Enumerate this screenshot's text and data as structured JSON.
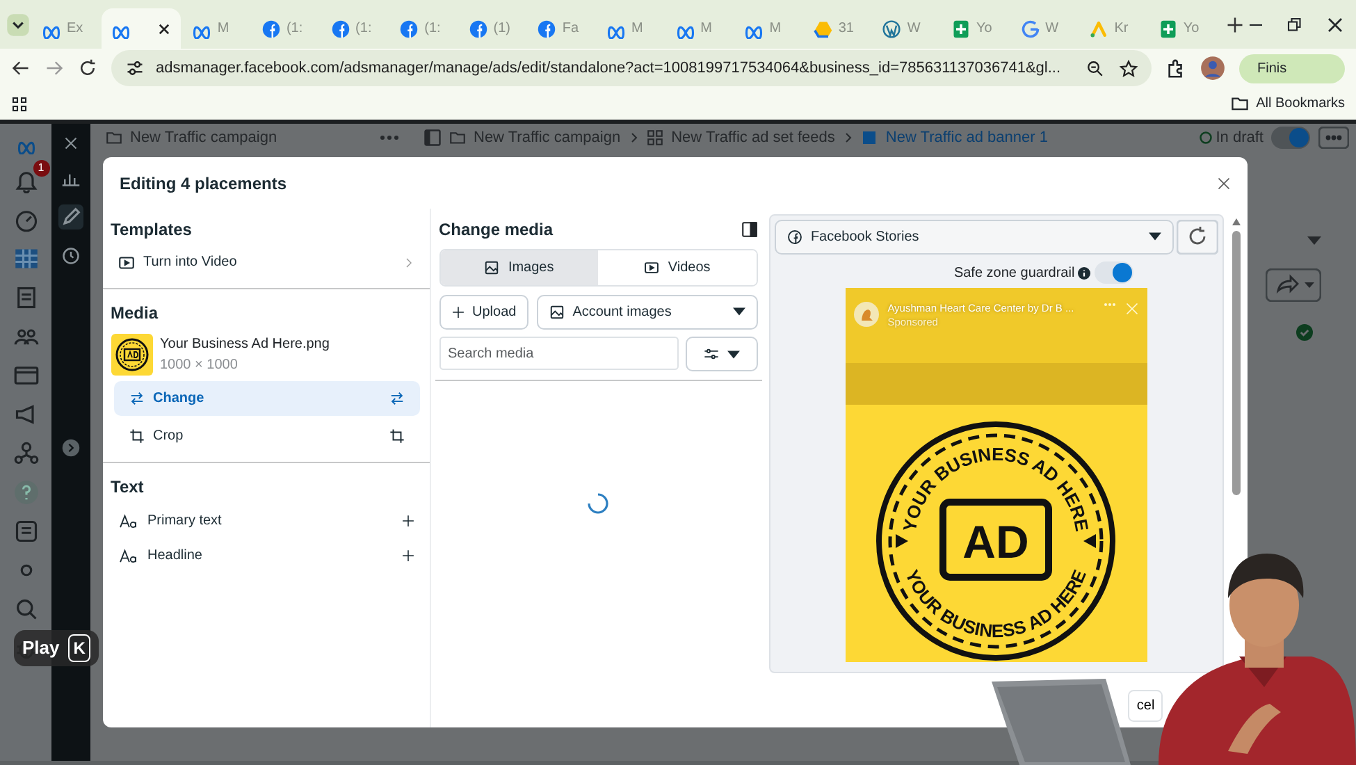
{
  "browser": {
    "tabs": [
      {
        "kind": "meta",
        "label": "Ex",
        "selected": false
      },
      {
        "kind": "meta",
        "selected": true
      },
      {
        "kind": "meta",
        "label": "M",
        "selected": false
      },
      {
        "kind": "facebook",
        "label": "(1:",
        "selected": false
      },
      {
        "kind": "facebook",
        "label": "(1:",
        "selected": false
      },
      {
        "kind": "facebook",
        "label": "(1:",
        "selected": false
      },
      {
        "kind": "facebook",
        "label": "(1)",
        "selected": false
      },
      {
        "kind": "facebook",
        "label": "Fa",
        "selected": false
      },
      {
        "kind": "meta",
        "label": "M",
        "selected": false
      },
      {
        "kind": "meta",
        "label": "M",
        "selected": false
      },
      {
        "kind": "meta",
        "label": "M",
        "selected": false
      },
      {
        "kind": "drive",
        "label": "31",
        "selected": false
      },
      {
        "kind": "wordpress",
        "label": "W",
        "selected": false
      },
      {
        "kind": "sheets",
        "label": "Yo",
        "selected": false
      },
      {
        "kind": "google",
        "label": "W",
        "selected": false
      },
      {
        "kind": "ads",
        "label": "Kr",
        "selected": false
      },
      {
        "kind": "sheets",
        "label": "Yo",
        "selected": false
      }
    ],
    "url": "adsmanager.facebook.com/adsmanager/manage/ads/edit/standalone?act=1008199717534064&business_id=785631137036741&gl...",
    "profile_button": "Finis",
    "bookmarks": "All Bookmarks"
  },
  "app": {
    "notification_count": "1",
    "campaign": "New Traffic campaign",
    "breadcrumbs": [
      {
        "label": "New Traffic campaign",
        "kind": "campaign"
      },
      {
        "label": "New Traffic ad set feeds",
        "kind": "adset"
      },
      {
        "label": "New Traffic ad banner 1",
        "kind": "ad"
      }
    ],
    "status": "In draft",
    "ad_toggle": {
      "on": true
    }
  },
  "dialog": {
    "title": "Editing 4 placements",
    "templates": {
      "heading": "Templates",
      "item": "Turn into Video"
    },
    "media": {
      "heading": "Media",
      "file_name": "Your Business Ad Here.png",
      "dimensions": "1000 × 1000",
      "actions": [
        {
          "label": "Change",
          "kind": "swap",
          "selected": true
        },
        {
          "label": "Crop",
          "kind": "crop",
          "selected": false
        }
      ]
    },
    "text": {
      "heading": "Text",
      "items": [
        {
          "label": "Primary text"
        },
        {
          "label": "Headline"
        }
      ]
    },
    "change_media": {
      "title": "Change media",
      "tabs": [
        {
          "label": "Images",
          "kind": "images",
          "selected": true
        },
        {
          "label": "Videos",
          "kind": "videos",
          "selected": false
        }
      ],
      "upload": "Upload",
      "source": "Account images",
      "placeholder": "Search media",
      "loading": true
    },
    "preview": {
      "placement": "Facebook Stories",
      "safe_zone": {
        "label": "Safe zone guardrail",
        "on": true
      },
      "page_name": "Ayushman Heart Care Center by Dr B ...",
      "sponsored": "Sponsored",
      "creative": {
        "badge": "AD",
        "ring_top": "YOUR BUSINESS AD HERE",
        "ring_bottom": "YOUR BUSINESS AD HERE"
      }
    },
    "cancel": "cel"
  },
  "player": {
    "tooltip": "Play",
    "shortcut": "K"
  }
}
